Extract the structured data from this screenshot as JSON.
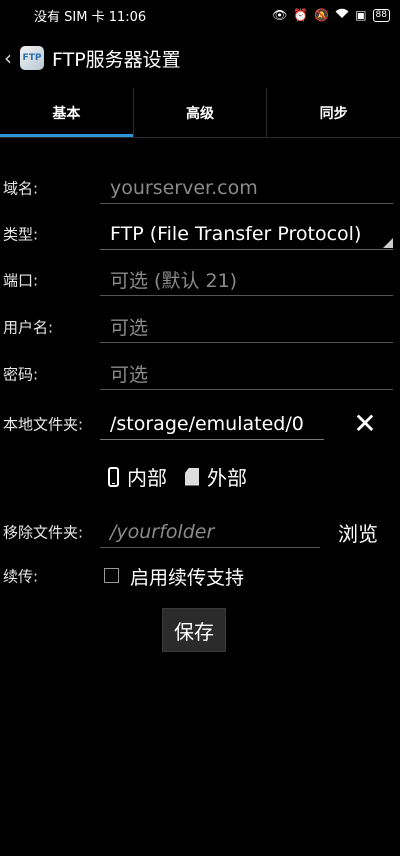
{
  "status_bar": {
    "carrier": "没有 SIM 卡",
    "time": "11:06",
    "battery": "88"
  },
  "app_bar": {
    "back": "‹",
    "icon_text": "FTP",
    "title": "FTP服务器设置"
  },
  "tabs": [
    {
      "label": "基本",
      "active": true
    },
    {
      "label": "高级",
      "active": false
    },
    {
      "label": "同步",
      "active": false
    }
  ],
  "form": {
    "domain": {
      "label": "域名:",
      "placeholder": "yourserver.com"
    },
    "type": {
      "label": "类型:",
      "value": "FTP (File Transfer Protocol)"
    },
    "port": {
      "label": "端口:",
      "placeholder": "可选 (默认 21)"
    },
    "username": {
      "label": "用户名:",
      "placeholder": "可选"
    },
    "password": {
      "label": "密码:",
      "placeholder": "可选"
    },
    "local_folder": {
      "label": "本地文件夹:",
      "value": "/storage/emulated/0",
      "clear": "✕"
    },
    "storage": {
      "internal": "内部",
      "external": "外部"
    },
    "remote_folder": {
      "label": "移除文件夹:",
      "placeholder": "/yourfolder",
      "browse": "浏览"
    },
    "resume": {
      "label": "续传:",
      "checkbox_label": "启用续传支持",
      "checked": false
    }
  },
  "save_label": "保存"
}
